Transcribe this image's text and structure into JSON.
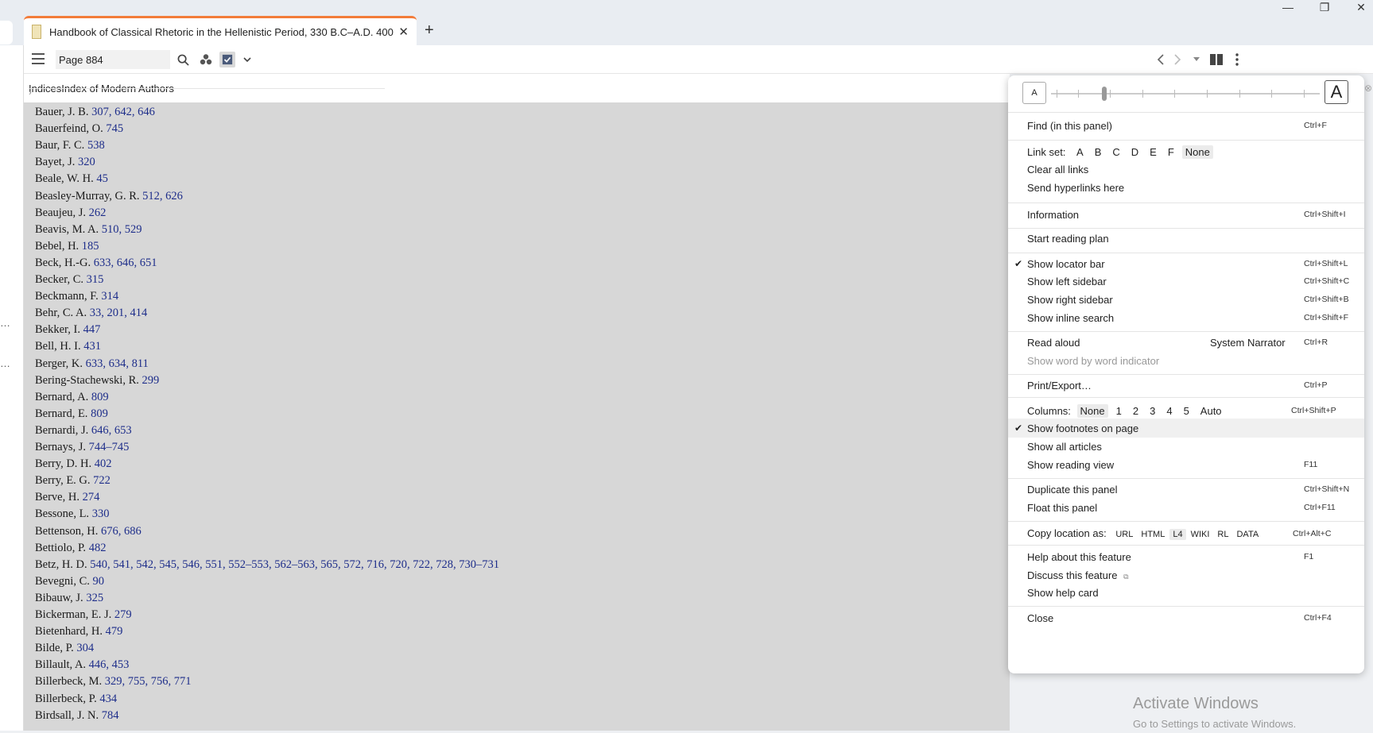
{
  "window": {
    "minimize": "—",
    "restore": "❐",
    "close": "✕"
  },
  "tab": {
    "title": "Handbook of Classical Rhetoric in the Hellenistic Period, 330 B.C–A.D. 400",
    "close": "✕",
    "new": "+"
  },
  "toolbar": {
    "page_value": "Page 884"
  },
  "breadcrumb": {
    "root": "Indices",
    "current": "Index of Modern Authors"
  },
  "entries": [
    {
      "name": "Bauer, J. B.",
      "refs": "307, 642, 646"
    },
    {
      "name": "Bauerfeind, O.",
      "refs": "745"
    },
    {
      "name": "Baur, F. C.",
      "refs": "538"
    },
    {
      "name": "Bayet, J.",
      "refs": "320"
    },
    {
      "name": "Beale, W. H.",
      "refs": "45"
    },
    {
      "name": "Beasley-Murray, G. R.",
      "refs": "512, 626"
    },
    {
      "name": "Beaujeu, J.",
      "refs": "262"
    },
    {
      "name": "Beavis, M. A.",
      "refs": "510, 529"
    },
    {
      "name": "Bebel, H.",
      "refs": "185"
    },
    {
      "name": "Beck, H.-G.",
      "refs": "633, 646, 651"
    },
    {
      "name": "Becker, C.",
      "refs": "315"
    },
    {
      "name": "Beckmann, F.",
      "refs": "314"
    },
    {
      "name": "Behr, C. A.",
      "refs": "33, 201, 414"
    },
    {
      "name": "Bekker, I.",
      "refs": "447"
    },
    {
      "name": "Bell, H. I.",
      "refs": "431"
    },
    {
      "name": "Berger, K.",
      "refs": "633, 634, 811"
    },
    {
      "name": "Bering-Stachewski, R.",
      "refs": "299"
    },
    {
      "name": "Bernard, A.",
      "refs": "809"
    },
    {
      "name": "Bernard, E.",
      "refs": "809"
    },
    {
      "name": "Bernardi, J.",
      "refs": "646, 653"
    },
    {
      "name": "Bernays, J.",
      "refs": "744–745"
    },
    {
      "name": "Berry, D. H.",
      "refs": "402"
    },
    {
      "name": "Berry, E. G.",
      "refs": "722"
    },
    {
      "name": "Berve, H.",
      "refs": "274"
    },
    {
      "name": "Bessone, L.",
      "refs": "330"
    },
    {
      "name": "Bettenson, H.",
      "refs": "676, 686"
    },
    {
      "name": "Bettiolo, P.",
      "refs": "482"
    },
    {
      "name": "Betz, H. D.",
      "refs": "540, 541, 542, 545, 546, 551, 552–553, 562–563, 565, 572, 716, 720, 722, 728, 730–731"
    },
    {
      "name": "Bevegni, C.",
      "refs": "90"
    },
    {
      "name": "Bibauw, J.",
      "refs": "325"
    },
    {
      "name": "Bickerman, E. J.",
      "refs": "279"
    },
    {
      "name": "Bietenhard, H.",
      "refs": "479"
    },
    {
      "name": "Bilde, P.",
      "refs": "304"
    },
    {
      "name": "Billault, A.",
      "refs": "446, 453"
    },
    {
      "name": "Billerbeck, M.",
      "refs": "329, 755, 756, 771"
    },
    {
      "name": "Billerbeck, P.",
      "refs": "434"
    },
    {
      "name": "Birdsall, J. N.",
      "refs": "784"
    }
  ],
  "menu": {
    "font_small": "A",
    "font_large": "A",
    "find": {
      "label": "Find (in this panel)",
      "shortcut": "Ctrl+F"
    },
    "link_set": {
      "label": "Link set:",
      "options": [
        "A",
        "B",
        "C",
        "D",
        "E",
        "F",
        "None"
      ]
    },
    "clear_links": "Clear all links",
    "send_hyperlinks": "Send hyperlinks here",
    "information": {
      "label": "Information",
      "shortcut": "Ctrl+Shift+I"
    },
    "reading_plan": "Start reading plan",
    "locator_bar": {
      "label": "Show locator bar",
      "shortcut": "Ctrl+Shift+L"
    },
    "left_sidebar": {
      "label": "Show left sidebar",
      "shortcut": "Ctrl+Shift+C"
    },
    "right_sidebar": {
      "label": "Show right sidebar",
      "shortcut": "Ctrl+Shift+B"
    },
    "inline_search": {
      "label": "Show inline search",
      "shortcut": "Ctrl+Shift+F"
    },
    "read_aloud": {
      "label": "Read aloud",
      "voice": "System Narrator",
      "shortcut": "Ctrl+R"
    },
    "word_indicator": "Show word by word indicator",
    "print": {
      "label": "Print/Export…",
      "shortcut": "Ctrl+P"
    },
    "columns": {
      "label": "Columns:",
      "options": [
        "None",
        "1",
        "2",
        "3",
        "4",
        "5",
        "Auto"
      ],
      "shortcut": "Ctrl+Shift+P"
    },
    "footnotes": "Show footnotes on page",
    "all_articles": "Show all articles",
    "reading_view": {
      "label": "Show reading view",
      "shortcut": "F11"
    },
    "duplicate": {
      "label": "Duplicate this panel",
      "shortcut": "Ctrl+Shift+N"
    },
    "float": {
      "label": "Float this panel",
      "shortcut": "Ctrl+F11"
    },
    "copy_location": {
      "label": "Copy location as:",
      "options": [
        "URL",
        "HTML",
        "L4",
        "WIKI",
        "RL",
        "DATA"
      ],
      "shortcut": "Ctrl+Alt+C"
    },
    "help": {
      "label": "Help about this feature",
      "shortcut": "F1"
    },
    "discuss": "Discuss this feature",
    "help_card": "Show help card",
    "close": {
      "label": "Close",
      "shortcut": "Ctrl+F4"
    }
  },
  "watermark": {
    "title": "Activate Windows",
    "subtitle": "Go to Settings to activate Windows."
  }
}
